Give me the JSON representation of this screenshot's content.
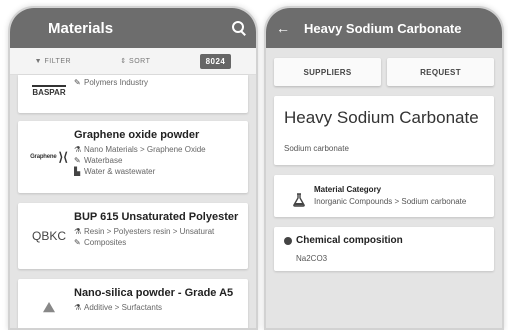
{
  "left_screen": {
    "appbar": {
      "title": "Materials",
      "menu_icon": "hamburger-icon",
      "search_icon": "search-icon"
    },
    "toolbar": {
      "filter_label": "▼ FILTER",
      "sort_label": "⇕ SORT",
      "count": "8024"
    },
    "cards": [
      {
        "logo_text": "BASPAR",
        "name": "",
        "lines": [
          {
            "icon": "brush-icon",
            "text": "Polymers Industry"
          }
        ]
      },
      {
        "logo_text": "Graphene",
        "name": "Graphene oxide powder",
        "lines": [
          {
            "icon": "flask-icon",
            "text": "Nano Materials > Graphene Oxide"
          },
          {
            "icon": "brush-icon",
            "text": "Waterbase"
          },
          {
            "icon": "factory-icon",
            "text": "Water & wastewater"
          }
        ]
      },
      {
        "logo_text": "QBKC",
        "name": "BUP 615 Unsaturated Polyester",
        "lines": [
          {
            "icon": "flask-icon",
            "text": "Resin > Polyesters resin > Unsaturat"
          },
          {
            "icon": "brush-icon",
            "text": "Composites"
          }
        ]
      },
      {
        "logo_text": "",
        "name": "Nano-silica powder - Grade A5",
        "lines": [
          {
            "icon": "flask-icon",
            "text": "Additive > Surfactants"
          }
        ]
      }
    ]
  },
  "right_screen": {
    "appbar": {
      "title": "Heavy Sodium Carbonate",
      "back_icon": "back-arrow-icon"
    },
    "tabs": {
      "suppliers": "SUPPLIERS",
      "request": "REQUEST"
    },
    "header": {
      "title": "Heavy Sodium Carbonate",
      "subtitle": "Sodium carbonate"
    },
    "category": {
      "label": "Material Category",
      "value": "Inorganic Compounds > Sodium carbonate"
    },
    "composition": {
      "label": "Chemical composition",
      "value": "Na2CO3"
    }
  }
}
